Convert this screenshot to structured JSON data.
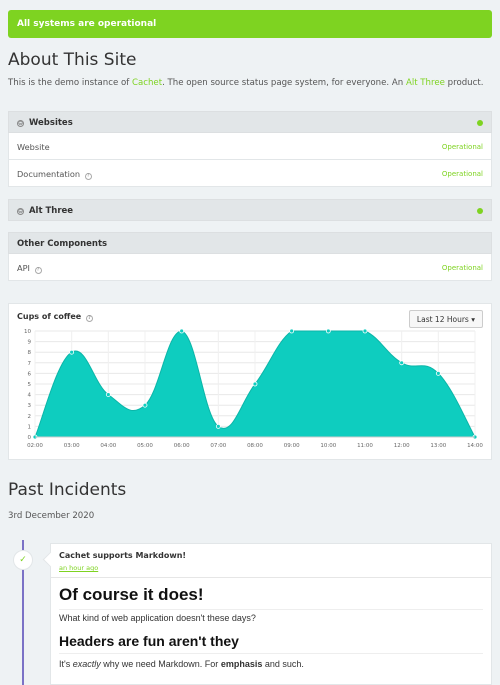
{
  "banner": {
    "text": "All systems are operational",
    "color": "#7ed321"
  },
  "about": {
    "title": "About This Site",
    "text_before": "This is the demo instance of ",
    "link1": "Cachet",
    "text_middle": ". The open source status page system, for everyone. An ",
    "link2": "Alt Three",
    "text_after": " product."
  },
  "groups": [
    {
      "name": "Websites",
      "components": [
        {
          "name": "Website",
          "status": "Operational"
        },
        {
          "name": "Documentation",
          "status": "Operational"
        }
      ]
    },
    {
      "name": "Alt Three",
      "components": []
    },
    {
      "name": "Other Components",
      "components": [
        {
          "name": "API",
          "status": "Operational"
        }
      ]
    }
  ],
  "metric": {
    "title": "Cups of coffee",
    "range_label": "Last 12 Hours",
    "range_caret": "▾"
  },
  "chart_data": {
    "type": "area",
    "title": "Cups of coffee",
    "x": [
      "02:00",
      "03:00",
      "04:00",
      "05:00",
      "06:00",
      "07:00",
      "08:00",
      "09:00",
      "10:00",
      "11:00",
      "12:00",
      "13:00",
      "14:00"
    ],
    "values": [
      0,
      8,
      4,
      3,
      10,
      1,
      5,
      10,
      10,
      10,
      7,
      6,
      0
    ],
    "ylim": [
      0,
      10
    ],
    "yticks": [
      0,
      1,
      2,
      3,
      4,
      5,
      6,
      7,
      8,
      9,
      10
    ],
    "grid": true,
    "color": "#0ecdbf"
  },
  "incidents": {
    "title": "Past Incidents",
    "date": "3rd December 2020",
    "items": [
      {
        "name": "Cachet supports Markdown!",
        "time": "an hour ago",
        "heading1": "Of course it does!",
        "para1": "What kind of web application doesn't these days?",
        "heading2": "Headers are fun aren't they",
        "para2_a": "It's ",
        "para2_em": "exactly",
        "para2_b": " why we need Markdown. For ",
        "para2_strong": "emphasis",
        "para2_c": " and such."
      }
    ]
  },
  "icons": {
    "toggle": "⊖",
    "help": "?",
    "check": "✓"
  }
}
